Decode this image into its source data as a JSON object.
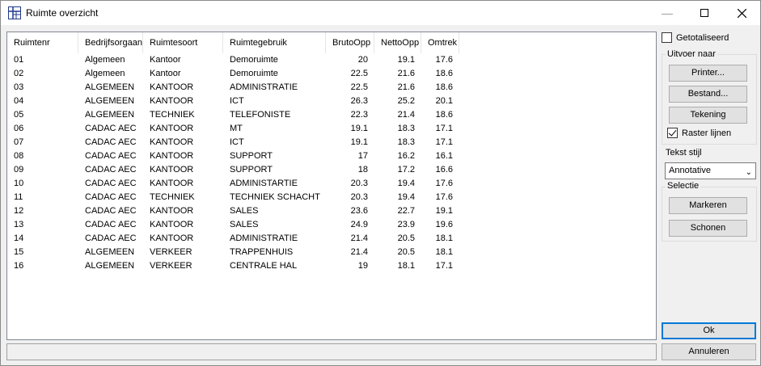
{
  "window": {
    "title": "Ruimte overzicht"
  },
  "table": {
    "columns": [
      "Ruimtenr",
      "Bedrijfsorgaan",
      "Ruimtesoort",
      "Ruimtegebruik",
      "BrutoOpp",
      "NettoOpp",
      "Omtrek"
    ],
    "rows": [
      [
        "01",
        "Algemeen",
        "Kantoor",
        "Demoruimte",
        "20",
        "19.1",
        "17.6"
      ],
      [
        "02",
        "Algemeen",
        "Kantoor",
        "Demoruimte",
        "22.5",
        "21.6",
        "18.6"
      ],
      [
        "03",
        "ALGEMEEN",
        "KANTOOR",
        "ADMINISTRATIE",
        "22.5",
        "21.6",
        "18.6"
      ],
      [
        "04",
        "ALGEMEEN",
        "KANTOOR",
        "ICT",
        "26.3",
        "25.2",
        "20.1"
      ],
      [
        "05",
        "ALGEMEEN",
        "TECHNIEK",
        "TELEFONISTE",
        "22.3",
        "21.4",
        "18.6"
      ],
      [
        "06",
        "CADAC AEC",
        "KANTOOR",
        "MT",
        "19.1",
        "18.3",
        "17.1"
      ],
      [
        "07",
        "CADAC AEC",
        "KANTOOR",
        "ICT",
        "19.1",
        "18.3",
        "17.1"
      ],
      [
        "08",
        "CADAC AEC",
        "KANTOOR",
        "SUPPORT",
        "17",
        "16.2",
        "16.1"
      ],
      [
        "09",
        "CADAC AEC",
        "KANTOOR",
        "SUPPORT",
        "18",
        "17.2",
        "16.6"
      ],
      [
        "10",
        "CADAC AEC",
        "KANTOOR",
        "ADMINISTARTIE",
        "20.3",
        "19.4",
        "17.6"
      ],
      [
        "11",
        "CADAC AEC",
        "TECHNIEK",
        "TECHNIEK SCHACHT",
        "20.3",
        "19.4",
        "17.6"
      ],
      [
        "12",
        "CADAC AEC",
        "KANTOOR",
        "SALES",
        "23.6",
        "22.7",
        "19.1"
      ],
      [
        "13",
        "CADAC AEC",
        "KANTOOR",
        "SALES",
        "24.9",
        "23.9",
        "19.6"
      ],
      [
        "14",
        "CADAC AEC",
        "KANTOOR",
        "ADMINISTRATIE",
        "21.4",
        "20.5",
        "18.1"
      ],
      [
        "15",
        "ALGEMEEN",
        "VERKEER",
        "TRAPPENHUIS",
        "21.4",
        "20.5",
        "18.1"
      ],
      [
        "16",
        "ALGEMEEN",
        "VERKEER",
        "CENTRALE HAL",
        "19",
        "18.1",
        "17.1"
      ]
    ]
  },
  "side": {
    "totalized_label": "Getotaliseerd",
    "totalized_checked": false,
    "output_group": "Uitvoer naar",
    "printer_label": "Printer...",
    "file_label": "Bestand...",
    "drawing_label": "Tekening",
    "grid_label": "Raster lijnen",
    "grid_checked": true,
    "text_style_label": "Tekst stijl",
    "text_style_value": "Annotative",
    "selection_group": "Selectie",
    "mark_label": "Markeren",
    "clear_label": "Schonen",
    "ok_label": "Ok",
    "cancel_label": "Annuleren"
  }
}
